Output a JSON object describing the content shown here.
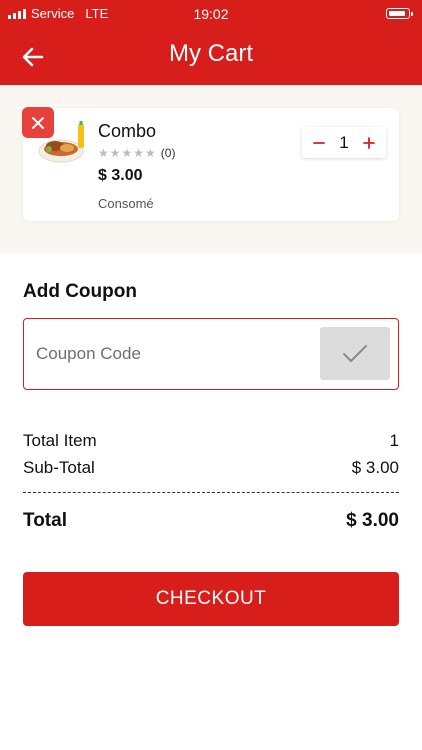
{
  "status_bar": {
    "carrier": "Service",
    "network": "LTE",
    "time": "19:02",
    "battery_level": 0.9
  },
  "header": {
    "title": "My Cart",
    "back_icon": "arrow-left-icon"
  },
  "cart": {
    "items": [
      {
        "name": "Combo",
        "rating_count": "(0)",
        "price": "$ 3.00",
        "category": "Consomé",
        "quantity": "1",
        "rating_stars": 0,
        "remove_icon": "close-icon"
      }
    ]
  },
  "coupon": {
    "heading": "Add Coupon",
    "placeholder": "Coupon Code",
    "value": "",
    "apply_icon": "check-icon"
  },
  "summary": {
    "total_item_label": "Total Item",
    "total_item_value": "1",
    "subtotal_label": "Sub-Total",
    "subtotal_value": "$ 3.00",
    "total_label": "Total",
    "total_value": "$ 3.00"
  },
  "checkout": {
    "label": "CHECKOUT"
  },
  "colors": {
    "primary": "#d71e1a",
    "remove": "#e8403a",
    "background_section": "#faf7f2"
  }
}
